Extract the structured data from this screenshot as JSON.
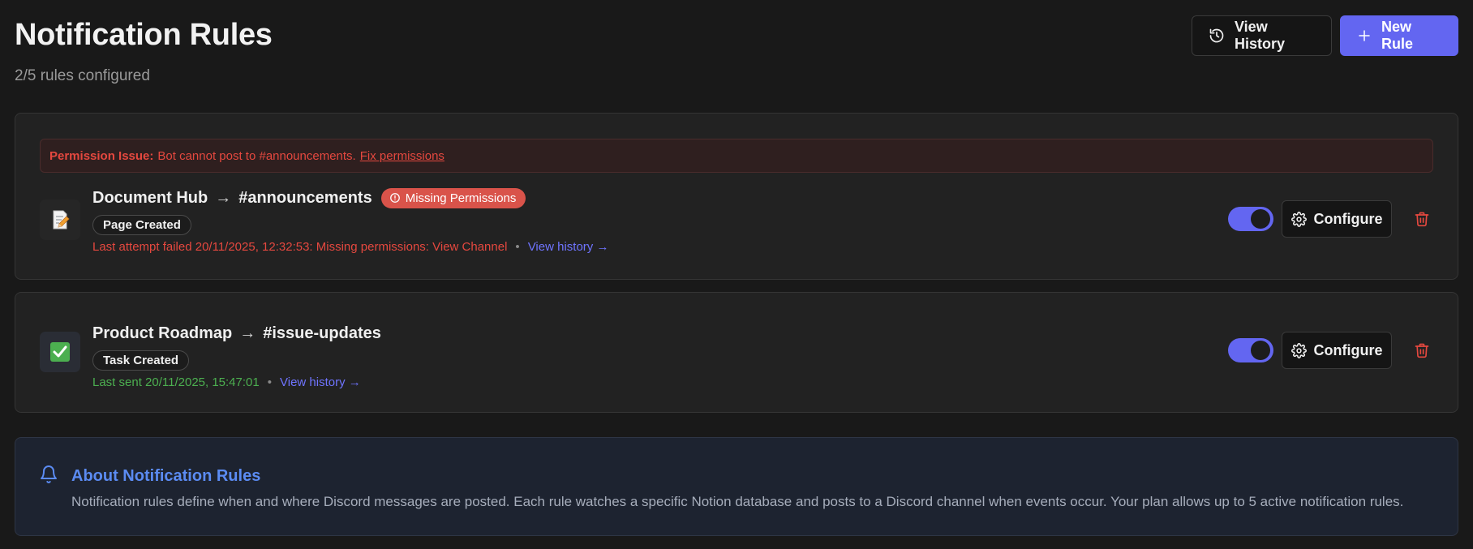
{
  "header": {
    "title": "Notification Rules",
    "subtitle": "2/5 rules configured",
    "view_history_label": "View History",
    "new_rule_label": "New Rule"
  },
  "rules": [
    {
      "alert": {
        "strong": "Permission Issue:",
        "message": "Bot cannot post to #announcements.",
        "link": "Fix permissions"
      },
      "database": "Document Hub",
      "arrow": "→",
      "channel": "#announcements",
      "badge": "Missing Permissions",
      "trigger": "Page Created",
      "status": "Last attempt failed 20/11/2025, 12:32:53: Missing permissions: View Channel",
      "separator": "•",
      "history_link": "View history →",
      "enabled": true,
      "configure_label": "Configure",
      "icon": "memo-icon"
    },
    {
      "database": "Product Roadmap",
      "arrow": "→",
      "channel": "#issue-updates",
      "trigger": "Task Created",
      "status": "Last sent 20/11/2025, 15:47:01",
      "separator": "•",
      "history_link": "View history →",
      "enabled": true,
      "configure_label": "Configure",
      "icon": "check-mark-icon"
    }
  ],
  "info": {
    "title": "About Notification Rules",
    "text": "Notification rules define when and where Discord messages are posted. Each rule watches a specific Notion database and posts to a Discord channel when events occur. Your plan allows up to 5 active notification rules."
  },
  "colors": {
    "accent": "#6366f1",
    "error": "#e5483f",
    "success": "#4caf50",
    "info_title": "#5b8bf2",
    "background": "#191919"
  }
}
